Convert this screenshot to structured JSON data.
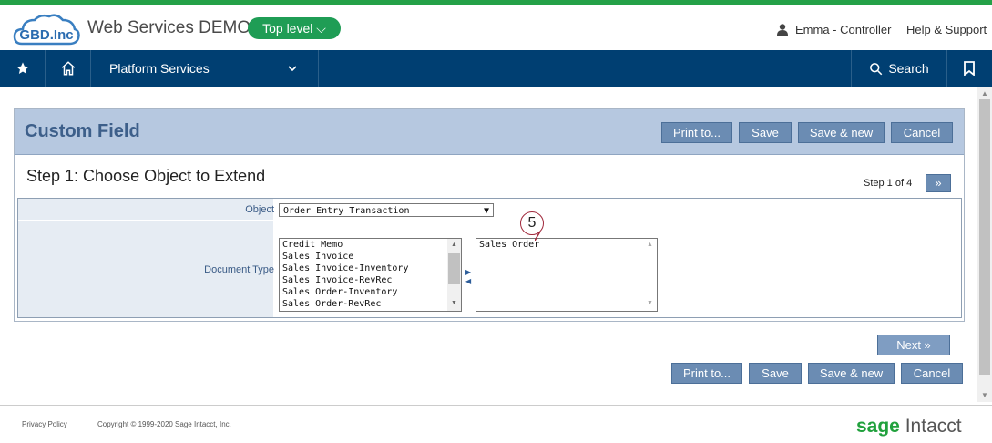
{
  "header": {
    "logo_text": "GBD.Inc",
    "company_name": "Web Services DEMO",
    "level_button": "Top level",
    "user": "Emma - Controller",
    "help": "Help & Support"
  },
  "nav": {
    "platform_services": "Platform Services",
    "search": "Search"
  },
  "page": {
    "title": "Custom Field",
    "top_buttons": [
      "Print to...",
      "Save",
      "Save & new",
      "Cancel"
    ],
    "step_title": "Step 1: Choose Object to Extend",
    "step_info": "Step 1 of 4",
    "step_next_glyph": "»"
  },
  "form": {
    "object_label": "Object",
    "object_value": "Order Entry Transaction",
    "document_type_label": "Document Type",
    "available_types": [
      "Credit Memo",
      "Sales Invoice",
      "Sales Invoice-Inventory",
      "Sales Invoice-RevRec",
      "Sales Order-Inventory",
      "Sales Order-RevRec"
    ],
    "selected_types": [
      "Sales Order"
    ]
  },
  "callout": "5",
  "bottom": {
    "next_label": "Next »",
    "buttons": [
      "Print to...",
      "Save",
      "Save & new",
      "Cancel"
    ]
  },
  "footer": {
    "privacy": "Privacy Policy",
    "copyright": "Copyright © 1999-2020 Sage Intacct, Inc.",
    "brand_sage": "sage",
    "brand_intacct": "Intacct"
  },
  "colors": {
    "accent_green": "#24a148",
    "nav_blue": "#003f72",
    "button_blue": "#6b8cb3"
  }
}
